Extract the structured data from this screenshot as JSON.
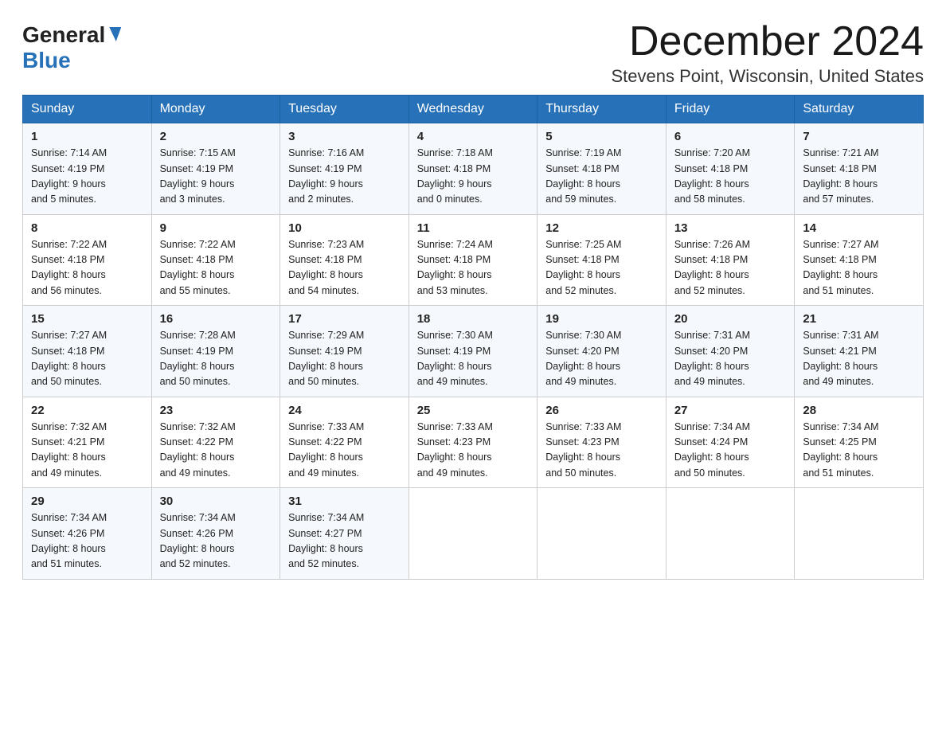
{
  "header": {
    "logo_general": "General",
    "logo_blue": "Blue",
    "month_title": "December 2024",
    "location": "Stevens Point, Wisconsin, United States"
  },
  "days_of_week": [
    "Sunday",
    "Monday",
    "Tuesday",
    "Wednesday",
    "Thursday",
    "Friday",
    "Saturday"
  ],
  "weeks": [
    [
      {
        "num": "1",
        "sunrise": "7:14 AM",
        "sunset": "4:19 PM",
        "daylight": "9 hours and 5 minutes."
      },
      {
        "num": "2",
        "sunrise": "7:15 AM",
        "sunset": "4:19 PM",
        "daylight": "9 hours and 3 minutes."
      },
      {
        "num": "3",
        "sunrise": "7:16 AM",
        "sunset": "4:19 PM",
        "daylight": "9 hours and 2 minutes."
      },
      {
        "num": "4",
        "sunrise": "7:18 AM",
        "sunset": "4:18 PM",
        "daylight": "9 hours and 0 minutes."
      },
      {
        "num": "5",
        "sunrise": "7:19 AM",
        "sunset": "4:18 PM",
        "daylight": "8 hours and 59 minutes."
      },
      {
        "num": "6",
        "sunrise": "7:20 AM",
        "sunset": "4:18 PM",
        "daylight": "8 hours and 58 minutes."
      },
      {
        "num": "7",
        "sunrise": "7:21 AM",
        "sunset": "4:18 PM",
        "daylight": "8 hours and 57 minutes."
      }
    ],
    [
      {
        "num": "8",
        "sunrise": "7:22 AM",
        "sunset": "4:18 PM",
        "daylight": "8 hours and 56 minutes."
      },
      {
        "num": "9",
        "sunrise": "7:22 AM",
        "sunset": "4:18 PM",
        "daylight": "8 hours and 55 minutes."
      },
      {
        "num": "10",
        "sunrise": "7:23 AM",
        "sunset": "4:18 PM",
        "daylight": "8 hours and 54 minutes."
      },
      {
        "num": "11",
        "sunrise": "7:24 AM",
        "sunset": "4:18 PM",
        "daylight": "8 hours and 53 minutes."
      },
      {
        "num": "12",
        "sunrise": "7:25 AM",
        "sunset": "4:18 PM",
        "daylight": "8 hours and 52 minutes."
      },
      {
        "num": "13",
        "sunrise": "7:26 AM",
        "sunset": "4:18 PM",
        "daylight": "8 hours and 52 minutes."
      },
      {
        "num": "14",
        "sunrise": "7:27 AM",
        "sunset": "4:18 PM",
        "daylight": "8 hours and 51 minutes."
      }
    ],
    [
      {
        "num": "15",
        "sunrise": "7:27 AM",
        "sunset": "4:18 PM",
        "daylight": "8 hours and 50 minutes."
      },
      {
        "num": "16",
        "sunrise": "7:28 AM",
        "sunset": "4:19 PM",
        "daylight": "8 hours and 50 minutes."
      },
      {
        "num": "17",
        "sunrise": "7:29 AM",
        "sunset": "4:19 PM",
        "daylight": "8 hours and 50 minutes."
      },
      {
        "num": "18",
        "sunrise": "7:30 AM",
        "sunset": "4:19 PM",
        "daylight": "8 hours and 49 minutes."
      },
      {
        "num": "19",
        "sunrise": "7:30 AM",
        "sunset": "4:20 PM",
        "daylight": "8 hours and 49 minutes."
      },
      {
        "num": "20",
        "sunrise": "7:31 AM",
        "sunset": "4:20 PM",
        "daylight": "8 hours and 49 minutes."
      },
      {
        "num": "21",
        "sunrise": "7:31 AM",
        "sunset": "4:21 PM",
        "daylight": "8 hours and 49 minutes."
      }
    ],
    [
      {
        "num": "22",
        "sunrise": "7:32 AM",
        "sunset": "4:21 PM",
        "daylight": "8 hours and 49 minutes."
      },
      {
        "num": "23",
        "sunrise": "7:32 AM",
        "sunset": "4:22 PM",
        "daylight": "8 hours and 49 minutes."
      },
      {
        "num": "24",
        "sunrise": "7:33 AM",
        "sunset": "4:22 PM",
        "daylight": "8 hours and 49 minutes."
      },
      {
        "num": "25",
        "sunrise": "7:33 AM",
        "sunset": "4:23 PM",
        "daylight": "8 hours and 49 minutes."
      },
      {
        "num": "26",
        "sunrise": "7:33 AM",
        "sunset": "4:23 PM",
        "daylight": "8 hours and 50 minutes."
      },
      {
        "num": "27",
        "sunrise": "7:34 AM",
        "sunset": "4:24 PM",
        "daylight": "8 hours and 50 minutes."
      },
      {
        "num": "28",
        "sunrise": "7:34 AM",
        "sunset": "4:25 PM",
        "daylight": "8 hours and 51 minutes."
      }
    ],
    [
      {
        "num": "29",
        "sunrise": "7:34 AM",
        "sunset": "4:26 PM",
        "daylight": "8 hours and 51 minutes."
      },
      {
        "num": "30",
        "sunrise": "7:34 AM",
        "sunset": "4:26 PM",
        "daylight": "8 hours and 52 minutes."
      },
      {
        "num": "31",
        "sunrise": "7:34 AM",
        "sunset": "4:27 PM",
        "daylight": "8 hours and 52 minutes."
      },
      null,
      null,
      null,
      null
    ]
  ],
  "labels": {
    "sunrise": "Sunrise:",
    "sunset": "Sunset:",
    "daylight": "Daylight:"
  }
}
